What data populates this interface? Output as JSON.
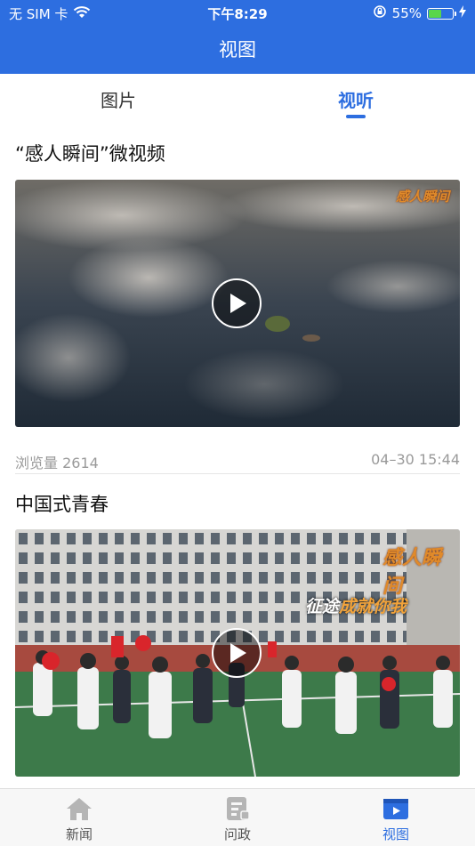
{
  "status_bar": {
    "carrier": "无 SIM 卡",
    "time": "下午8:29",
    "battery_percent": "55%",
    "battery_level": 0.55,
    "icons": [
      "wifi-icon",
      "rotation-lock-icon",
      "battery-icon",
      "charging-bolt-icon"
    ]
  },
  "header": {
    "title": "视图"
  },
  "tabs": [
    {
      "label": "图片",
      "active": false
    },
    {
      "label": "视听",
      "active": true
    }
  ],
  "videos": [
    {
      "title": "“感人瞬间”微视频",
      "watermark": "感人瞬间",
      "views_label": "浏览量 2614",
      "date": "04–30 15:44"
    },
    {
      "title": "中国式青春",
      "watermark": "感人瞬间",
      "caption_a": "征途",
      "caption_b": "成就你我"
    }
  ],
  "bottom_nav": [
    {
      "label": "新闻",
      "icon": "home-icon",
      "active": false
    },
    {
      "label": "问政",
      "icon": "document-icon",
      "active": false
    },
    {
      "label": "视图",
      "icon": "video-icon",
      "active": true
    }
  ],
  "colors": {
    "primary": "#2d6ee0",
    "background": "#ffffff",
    "muted_text": "#9a9a9a",
    "nav_background": "#f7f7f7"
  }
}
